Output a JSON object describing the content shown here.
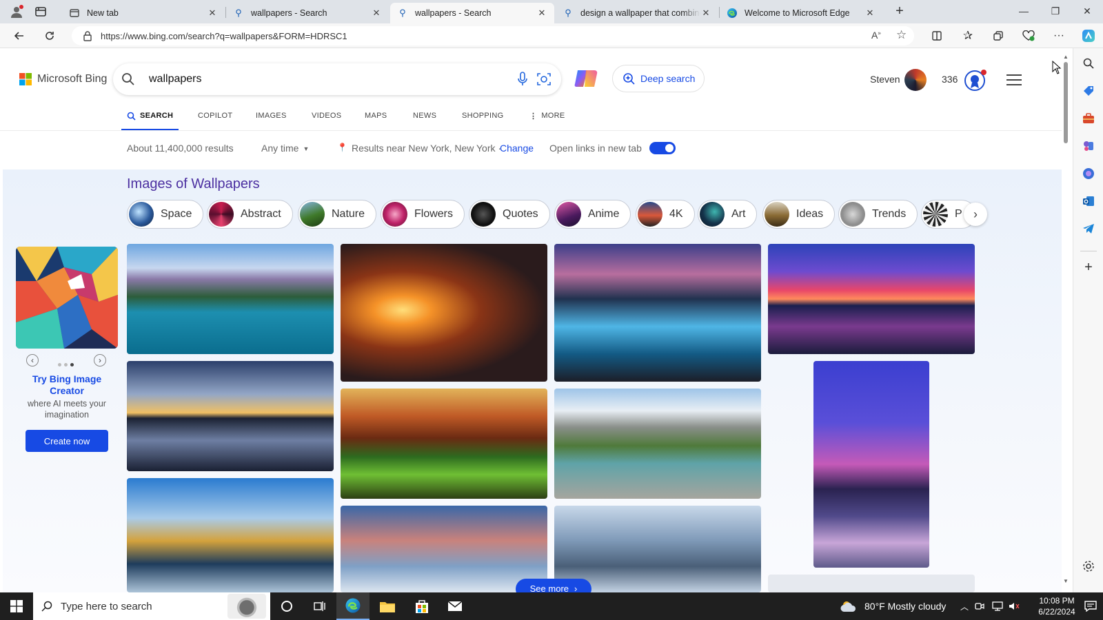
{
  "tabs": [
    {
      "title": "New tab",
      "icon": "newtab-icon"
    },
    {
      "title": "wallpapers - Search",
      "icon": "search-icon"
    },
    {
      "title": "wallpapers - Search",
      "icon": "search-icon"
    },
    {
      "title": "design a wallpaper that combine",
      "icon": "search-icon"
    },
    {
      "title": "Welcome to Microsoft Edge",
      "icon": "edge-icon"
    }
  ],
  "address": {
    "url": "https://www.bing.com/search?q=wallpapers&FORM=HDRSC1"
  },
  "bing": {
    "logo_text": "Microsoft Bing",
    "query": "wallpapers",
    "deep_search": "Deep search",
    "user_name": "Steven",
    "rewards_points": "336"
  },
  "nav": [
    "SEARCH",
    "COPILOT",
    "IMAGES",
    "VIDEOS",
    "MAPS",
    "NEWS",
    "SHOPPING",
    "MORE"
  ],
  "filters": {
    "results_count": "About 11,400,000 results",
    "time": "Any time",
    "location_text": "Results near New York, New York ·",
    "change": "Change",
    "open_links": "Open links in new tab",
    "open_links_on": true
  },
  "images_section": {
    "title": "Images of Wallpapers",
    "chips": [
      "Space",
      "Abstract",
      "Nature",
      "Flowers",
      "Quotes",
      "Anime",
      "4K",
      "Art",
      "Ideas",
      "Trends",
      "P"
    ],
    "see_more": "See more"
  },
  "creator_card": {
    "title": "Try Bing Image Creator",
    "subtitle": "where AI meets your imagination",
    "button": "Create now"
  },
  "taskbar": {
    "search_placeholder": "Type here to search",
    "weather": "80°F  Mostly cloudy",
    "time": "10:08 PM",
    "date": "6/22/2024"
  },
  "colors": {
    "accent": "#174ae4",
    "toggle": "#174ae4",
    "taskbar": "#1f1f1f"
  }
}
